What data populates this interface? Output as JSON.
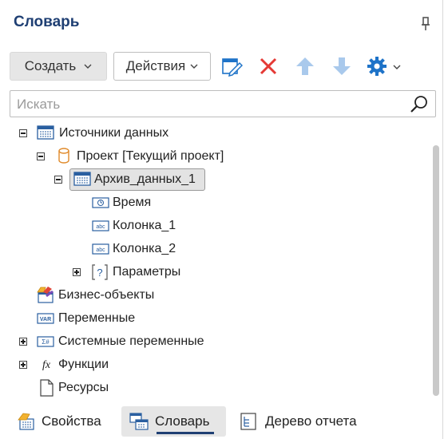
{
  "panel": {
    "title": "Словарь"
  },
  "toolbar": {
    "create_label": "Создать",
    "actions_label": "Действия",
    "icons": [
      "edit-icon",
      "delete-icon",
      "move-up-icon",
      "move-down-icon",
      "settings-icon"
    ]
  },
  "search": {
    "placeholder": "Искать",
    "value": ""
  },
  "tree": {
    "data_sources": "Источники данных",
    "project": "Проект [Текущий проект]",
    "archive": "Архив_данных_1",
    "time": "Время",
    "column1": "Колонка_1",
    "column2": "Колонка_2",
    "parameters": "Параметры",
    "business_objects": "Бизнес-объекты",
    "variables": "Переменные",
    "system_variables": "Системные переменные",
    "functions": "Функции",
    "resources": "Ресурсы"
  },
  "icon_text": {
    "time": "◷",
    "abc": "abc",
    "var": "VAR",
    "sys": "Σ#",
    "fx": "fx",
    "param": "?"
  },
  "tabs": {
    "properties": "Свойства",
    "dictionary": "Словарь",
    "report_tree": "Дерево отчета"
  },
  "colors": {
    "accent": "#1f3f73",
    "delete": "#e53935",
    "blue_icon": "#1e73c8",
    "disabled_arrow": "#a9c9ec"
  }
}
